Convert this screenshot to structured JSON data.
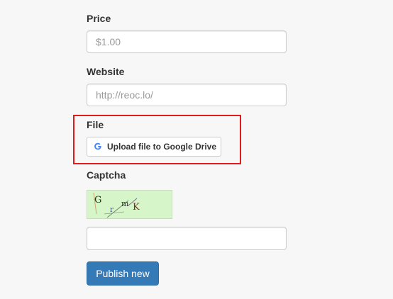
{
  "form": {
    "price": {
      "label": "Price",
      "placeholder": "$1.00"
    },
    "website": {
      "label": "Website",
      "placeholder": "http://reoc.lo/"
    },
    "file": {
      "label": "File",
      "upload_button_label": "Upload file to Google Drive",
      "upload_icon": "google-g-icon"
    },
    "captcha": {
      "label": "Captcha",
      "image_text": "GrmK",
      "input_value": ""
    },
    "publish_label": "Publish new"
  },
  "colors": {
    "primary_button": "#337ab7",
    "highlight": "#e01b1b",
    "captcha_background": "#d6f5c8",
    "google_blue": "#4285f4"
  }
}
